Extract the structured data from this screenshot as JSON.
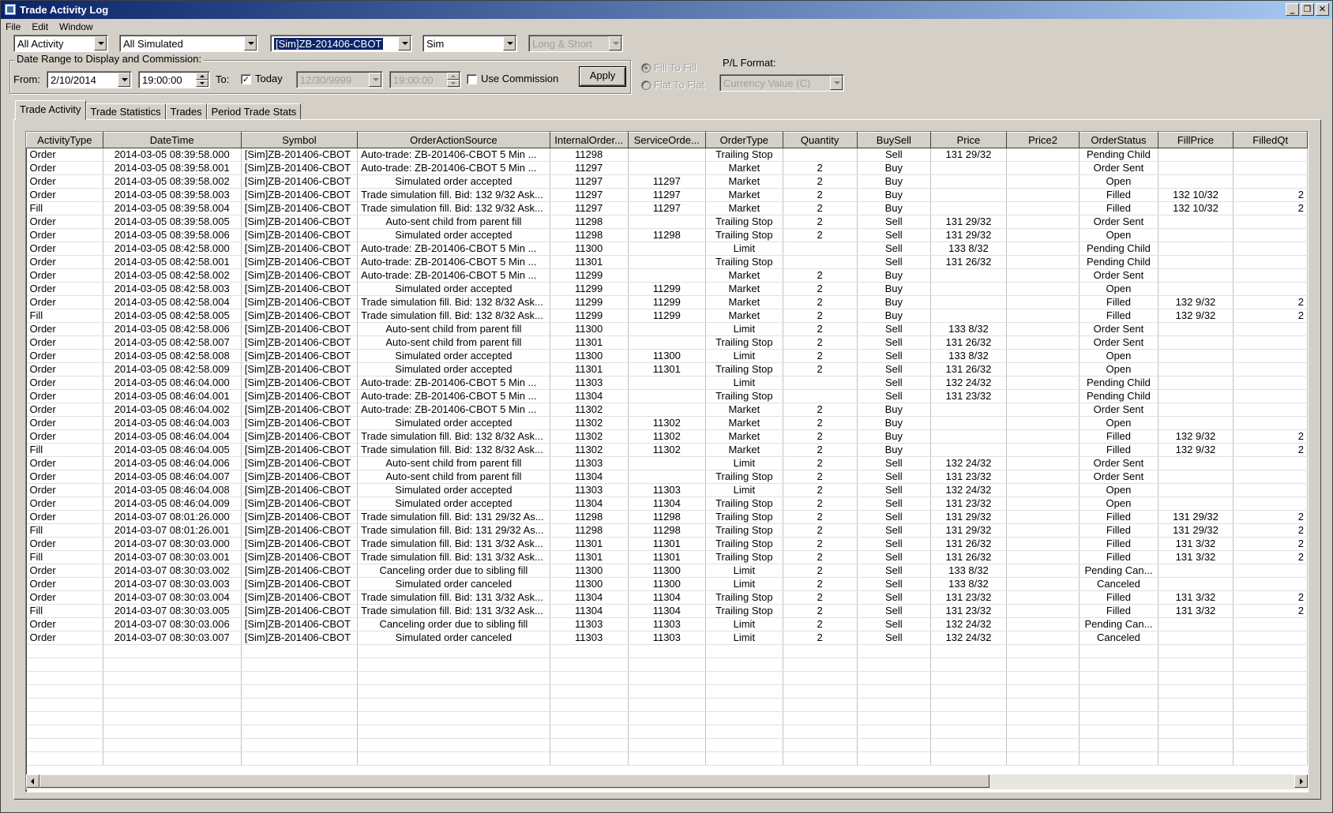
{
  "window": {
    "title": "Trade Activity Log"
  },
  "menu": [
    "File",
    "Edit",
    "Window"
  ],
  "filters": {
    "activity": "All Activity",
    "account": "All Simulated",
    "instrument": "[Sim]ZB-201406-CBOT",
    "connection": "Sim",
    "side": "Long & Short"
  },
  "date_range": {
    "group_label": "Date Range to Display and Commission:",
    "from_label": "From:",
    "from_date": "2/10/2014",
    "from_time": "19:00:00",
    "to_label": "To:",
    "today_checked": true,
    "today_label": "Today",
    "to_date": "12/30/9999",
    "to_time": "19:00:00",
    "use_commission_checked": false,
    "use_commission_label": "Use Commission",
    "apply_label": "Apply"
  },
  "fill_options": {
    "fill_to_fill": "Fill To Fill",
    "flat_to_flat": "Flat To Flat"
  },
  "pl_format": {
    "label": "P/L Format:",
    "value": "Currency Value (C)"
  },
  "tabs": [
    "Trade Activity",
    "Trade Statistics",
    "Trades",
    "Period Trade Stats"
  ],
  "grid": {
    "columns": [
      "ActivityType",
      "DateTime",
      "Symbol",
      "OrderActionSource",
      "InternalOrder...",
      "ServiceOrde...",
      "OrderType",
      "Quantity",
      "BuySell",
      "Price",
      "Price2",
      "OrderStatus",
      "FillPrice",
      "FilledQt"
    ],
    "rows": [
      [
        "Order",
        "2014-03-05 08:39:58.000",
        "[Sim]ZB-201406-CBOT",
        "Auto-trade: ZB-201406-CBOT  5 Min  ...",
        "11298",
        "",
        "Trailing Stop",
        "",
        "Sell",
        "131 29/32",
        "",
        "Pending Child",
        "",
        ""
      ],
      [
        "Order",
        "2014-03-05 08:39:58.001",
        "[Sim]ZB-201406-CBOT",
        "Auto-trade: ZB-201406-CBOT  5 Min  ...",
        "11297",
        "",
        "Market",
        "2",
        "Buy",
        "",
        "",
        "Order Sent",
        "",
        ""
      ],
      [
        "Order",
        "2014-03-05 08:39:58.002",
        "[Sim]ZB-201406-CBOT",
        "Simulated order accepted",
        "11297",
        "11297",
        "Market",
        "2",
        "Buy",
        "",
        "",
        "Open",
        "",
        ""
      ],
      [
        "Order",
        "2014-03-05 08:39:58.003",
        "[Sim]ZB-201406-CBOT",
        "Trade simulation fill. Bid: 132 9/32 Ask...",
        "11297",
        "11297",
        "Market",
        "2",
        "Buy",
        "",
        "",
        "Filled",
        "132 10/32",
        "2"
      ],
      [
        "Fill",
        "2014-03-05 08:39:58.004",
        "[Sim]ZB-201406-CBOT",
        "Trade simulation fill. Bid: 132 9/32 Ask...",
        "11297",
        "11297",
        "Market",
        "2",
        "Buy",
        "",
        "",
        "Filled",
        "132 10/32",
        "2"
      ],
      [
        "Order",
        "2014-03-05 08:39:58.005",
        "[Sim]ZB-201406-CBOT",
        "Auto-sent child from parent fill",
        "11298",
        "",
        "Trailing Stop",
        "2",
        "Sell",
        "131 29/32",
        "",
        "Order Sent",
        "",
        ""
      ],
      [
        "Order",
        "2014-03-05 08:39:58.006",
        "[Sim]ZB-201406-CBOT",
        "Simulated order accepted",
        "11298",
        "11298",
        "Trailing Stop",
        "2",
        "Sell",
        "131 29/32",
        "",
        "Open",
        "",
        ""
      ],
      [
        "Order",
        "2014-03-05 08:42:58.000",
        "[Sim]ZB-201406-CBOT",
        "Auto-trade: ZB-201406-CBOT  5 Min  ...",
        "11300",
        "",
        "Limit",
        "",
        "Sell",
        "133 8/32",
        "",
        "Pending Child",
        "",
        ""
      ],
      [
        "Order",
        "2014-03-05 08:42:58.001",
        "[Sim]ZB-201406-CBOT",
        "Auto-trade: ZB-201406-CBOT  5 Min  ...",
        "11301",
        "",
        "Trailing Stop",
        "",
        "Sell",
        "131 26/32",
        "",
        "Pending Child",
        "",
        ""
      ],
      [
        "Order",
        "2014-03-05 08:42:58.002",
        "[Sim]ZB-201406-CBOT",
        "Auto-trade: ZB-201406-CBOT  5 Min  ...",
        "11299",
        "",
        "Market",
        "2",
        "Buy",
        "",
        "",
        "Order Sent",
        "",
        ""
      ],
      [
        "Order",
        "2014-03-05 08:42:58.003",
        "[Sim]ZB-201406-CBOT",
        "Simulated order accepted",
        "11299",
        "11299",
        "Market",
        "2",
        "Buy",
        "",
        "",
        "Open",
        "",
        ""
      ],
      [
        "Order",
        "2014-03-05 08:42:58.004",
        "[Sim]ZB-201406-CBOT",
        "Trade simulation fill. Bid: 132 8/32 Ask...",
        "11299",
        "11299",
        "Market",
        "2",
        "Buy",
        "",
        "",
        "Filled",
        "132 9/32",
        "2"
      ],
      [
        "Fill",
        "2014-03-05 08:42:58.005",
        "[Sim]ZB-201406-CBOT",
        "Trade simulation fill. Bid: 132 8/32 Ask...",
        "11299",
        "11299",
        "Market",
        "2",
        "Buy",
        "",
        "",
        "Filled",
        "132 9/32",
        "2"
      ],
      [
        "Order",
        "2014-03-05 08:42:58.006",
        "[Sim]ZB-201406-CBOT",
        "Auto-sent child from parent fill",
        "11300",
        "",
        "Limit",
        "2",
        "Sell",
        "133 8/32",
        "",
        "Order Sent",
        "",
        ""
      ],
      [
        "Order",
        "2014-03-05 08:42:58.007",
        "[Sim]ZB-201406-CBOT",
        "Auto-sent child from parent fill",
        "11301",
        "",
        "Trailing Stop",
        "2",
        "Sell",
        "131 26/32",
        "",
        "Order Sent",
        "",
        ""
      ],
      [
        "Order",
        "2014-03-05 08:42:58.008",
        "[Sim]ZB-201406-CBOT",
        "Simulated order accepted",
        "11300",
        "11300",
        "Limit",
        "2",
        "Sell",
        "133 8/32",
        "",
        "Open",
        "",
        ""
      ],
      [
        "Order",
        "2014-03-05 08:42:58.009",
        "[Sim]ZB-201406-CBOT",
        "Simulated order accepted",
        "11301",
        "11301",
        "Trailing Stop",
        "2",
        "Sell",
        "131 26/32",
        "",
        "Open",
        "",
        ""
      ],
      [
        "Order",
        "2014-03-05 08:46:04.000",
        "[Sim]ZB-201406-CBOT",
        "Auto-trade: ZB-201406-CBOT  5 Min  ...",
        "11303",
        "",
        "Limit",
        "",
        "Sell",
        "132 24/32",
        "",
        "Pending Child",
        "",
        ""
      ],
      [
        "Order",
        "2014-03-05 08:46:04.001",
        "[Sim]ZB-201406-CBOT",
        "Auto-trade: ZB-201406-CBOT  5 Min  ...",
        "11304",
        "",
        "Trailing Stop",
        "",
        "Sell",
        "131 23/32",
        "",
        "Pending Child",
        "",
        ""
      ],
      [
        "Order",
        "2014-03-05 08:46:04.002",
        "[Sim]ZB-201406-CBOT",
        "Auto-trade: ZB-201406-CBOT  5 Min  ...",
        "11302",
        "",
        "Market",
        "2",
        "Buy",
        "",
        "",
        "Order Sent",
        "",
        ""
      ],
      [
        "Order",
        "2014-03-05 08:46:04.003",
        "[Sim]ZB-201406-CBOT",
        "Simulated order accepted",
        "11302",
        "11302",
        "Market",
        "2",
        "Buy",
        "",
        "",
        "Open",
        "",
        ""
      ],
      [
        "Order",
        "2014-03-05 08:46:04.004",
        "[Sim]ZB-201406-CBOT",
        "Trade simulation fill. Bid: 132 8/32 Ask...",
        "11302",
        "11302",
        "Market",
        "2",
        "Buy",
        "",
        "",
        "Filled",
        "132 9/32",
        "2"
      ],
      [
        "Fill",
        "2014-03-05 08:46:04.005",
        "[Sim]ZB-201406-CBOT",
        "Trade simulation fill. Bid: 132 8/32 Ask...",
        "11302",
        "11302",
        "Market",
        "2",
        "Buy",
        "",
        "",
        "Filled",
        "132 9/32",
        "2"
      ],
      [
        "Order",
        "2014-03-05 08:46:04.006",
        "[Sim]ZB-201406-CBOT",
        "Auto-sent child from parent fill",
        "11303",
        "",
        "Limit",
        "2",
        "Sell",
        "132 24/32",
        "",
        "Order Sent",
        "",
        ""
      ],
      [
        "Order",
        "2014-03-05 08:46:04.007",
        "[Sim]ZB-201406-CBOT",
        "Auto-sent child from parent fill",
        "11304",
        "",
        "Trailing Stop",
        "2",
        "Sell",
        "131 23/32",
        "",
        "Order Sent",
        "",
        ""
      ],
      [
        "Order",
        "2014-03-05 08:46:04.008",
        "[Sim]ZB-201406-CBOT",
        "Simulated order accepted",
        "11303",
        "11303",
        "Limit",
        "2",
        "Sell",
        "132 24/32",
        "",
        "Open",
        "",
        ""
      ],
      [
        "Order",
        "2014-03-05 08:46:04.009",
        "[Sim]ZB-201406-CBOT",
        "Simulated order accepted",
        "11304",
        "11304",
        "Trailing Stop",
        "2",
        "Sell",
        "131 23/32",
        "",
        "Open",
        "",
        ""
      ],
      [
        "Order",
        "2014-03-07 08:01:26.000",
        "[Sim]ZB-201406-CBOT",
        "Trade simulation fill. Bid: 131 29/32 As...",
        "11298",
        "11298",
        "Trailing Stop",
        "2",
        "Sell",
        "131 29/32",
        "",
        "Filled",
        "131 29/32",
        "2"
      ],
      [
        "Fill",
        "2014-03-07 08:01:26.001",
        "[Sim]ZB-201406-CBOT",
        "Trade simulation fill. Bid: 131 29/32 As...",
        "11298",
        "11298",
        "Trailing Stop",
        "2",
        "Sell",
        "131 29/32",
        "",
        "Filled",
        "131 29/32",
        "2"
      ],
      [
        "Order",
        "2014-03-07 08:30:03.000",
        "[Sim]ZB-201406-CBOT",
        "Trade simulation fill. Bid: 131 3/32 Ask...",
        "11301",
        "11301",
        "Trailing Stop",
        "2",
        "Sell",
        "131 26/32",
        "",
        "Filled",
        "131 3/32",
        "2"
      ],
      [
        "Fill",
        "2014-03-07 08:30:03.001",
        "[Sim]ZB-201406-CBOT",
        "Trade simulation fill. Bid: 131 3/32 Ask...",
        "11301",
        "11301",
        "Trailing Stop",
        "2",
        "Sell",
        "131 26/32",
        "",
        "Filled",
        "131 3/32",
        "2"
      ],
      [
        "Order",
        "2014-03-07 08:30:03.002",
        "[Sim]ZB-201406-CBOT",
        "Canceling order due to sibling fill",
        "11300",
        "11300",
        "Limit",
        "2",
        "Sell",
        "133 8/32",
        "",
        "Pending Can...",
        "",
        ""
      ],
      [
        "Order",
        "2014-03-07 08:30:03.003",
        "[Sim]ZB-201406-CBOT",
        "Simulated order canceled",
        "11300",
        "11300",
        "Limit",
        "2",
        "Sell",
        "133 8/32",
        "",
        "Canceled",
        "",
        ""
      ],
      [
        "Order",
        "2014-03-07 08:30:03.004",
        "[Sim]ZB-201406-CBOT",
        "Trade simulation fill. Bid: 131 3/32 Ask...",
        "11304",
        "11304",
        "Trailing Stop",
        "2",
        "Sell",
        "131 23/32",
        "",
        "Filled",
        "131 3/32",
        "2"
      ],
      [
        "Fill",
        "2014-03-07 08:30:03.005",
        "[Sim]ZB-201406-CBOT",
        "Trade simulation fill. Bid: 131 3/32 Ask...",
        "11304",
        "11304",
        "Trailing Stop",
        "2",
        "Sell",
        "131 23/32",
        "",
        "Filled",
        "131 3/32",
        "2"
      ],
      [
        "Order",
        "2014-03-07 08:30:03.006",
        "[Sim]ZB-201406-CBOT",
        "Canceling order due to sibling fill",
        "11303",
        "11303",
        "Limit",
        "2",
        "Sell",
        "132 24/32",
        "",
        "Pending Can...",
        "",
        ""
      ],
      [
        "Order",
        "2014-03-07 08:30:03.007",
        "[Sim]ZB-201406-CBOT",
        "Simulated order canceled",
        "11303",
        "11303",
        "Limit",
        "2",
        "Sell",
        "132 24/32",
        "",
        "Canceled",
        "",
        ""
      ]
    ]
  }
}
